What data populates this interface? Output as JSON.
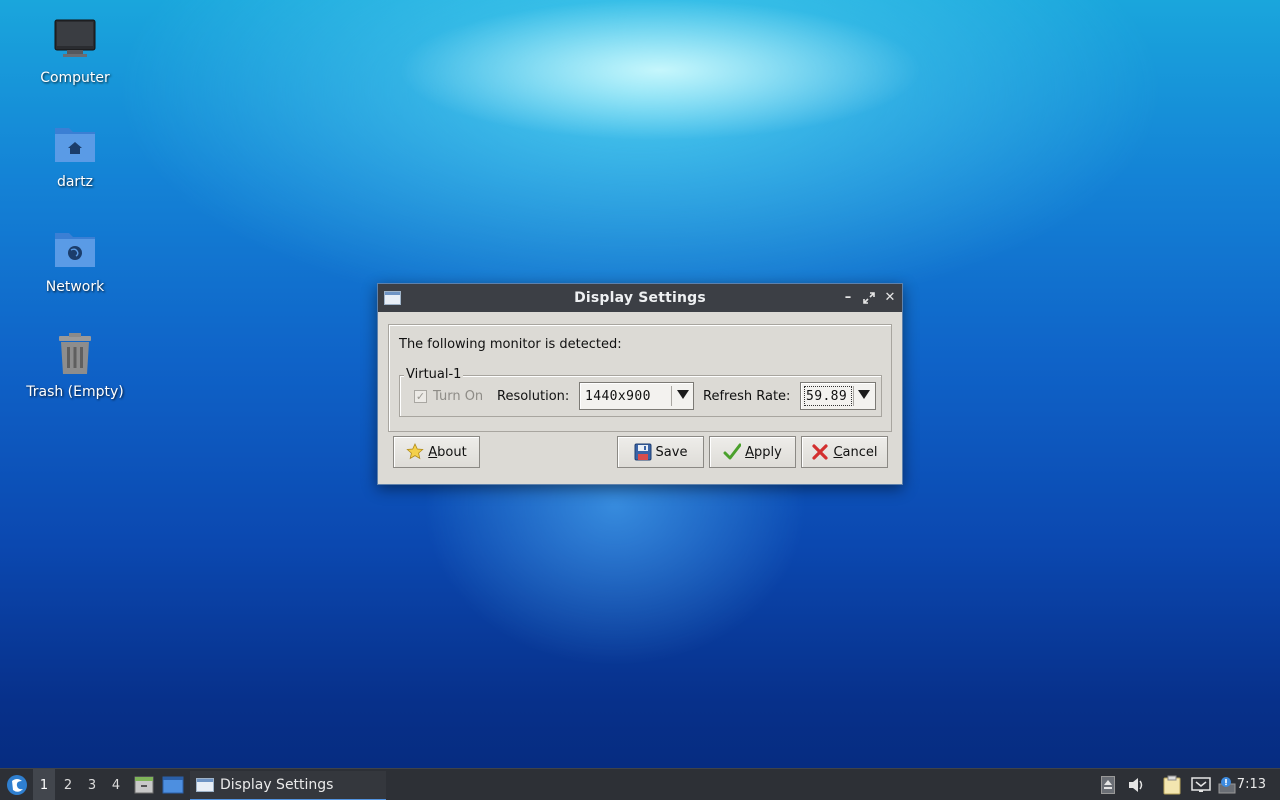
{
  "desktop": {
    "icons": [
      {
        "label": "Computer"
      },
      {
        "label": "dartz"
      },
      {
        "label": "Network"
      },
      {
        "label": "Trash (Empty)"
      }
    ]
  },
  "dialog": {
    "title": "Display Settings",
    "detected_text": "The following monitor is detected:",
    "monitor_name": "Virtual-1",
    "turn_on_label": "Turn On",
    "turn_on_checked": true,
    "resolution_label": "Resolution:",
    "resolution_value": "1440x900",
    "refresh_rate_label": "Refresh Rate:",
    "refresh_rate_value": "59.89",
    "buttons": {
      "about": {
        "mnemonic": "A",
        "rest": "bout"
      },
      "save": "Save",
      "apply": {
        "mnemonic": "A",
        "rest": "pply"
      },
      "cancel": {
        "mnemonic": "C",
        "rest": "ancel"
      }
    }
  },
  "taskbar": {
    "desktops": [
      "1",
      "2",
      "3",
      "4"
    ],
    "active_desktop": "1",
    "task_label": "Display Settings",
    "clock": "7:13",
    "accent_color": "#5294e2"
  }
}
